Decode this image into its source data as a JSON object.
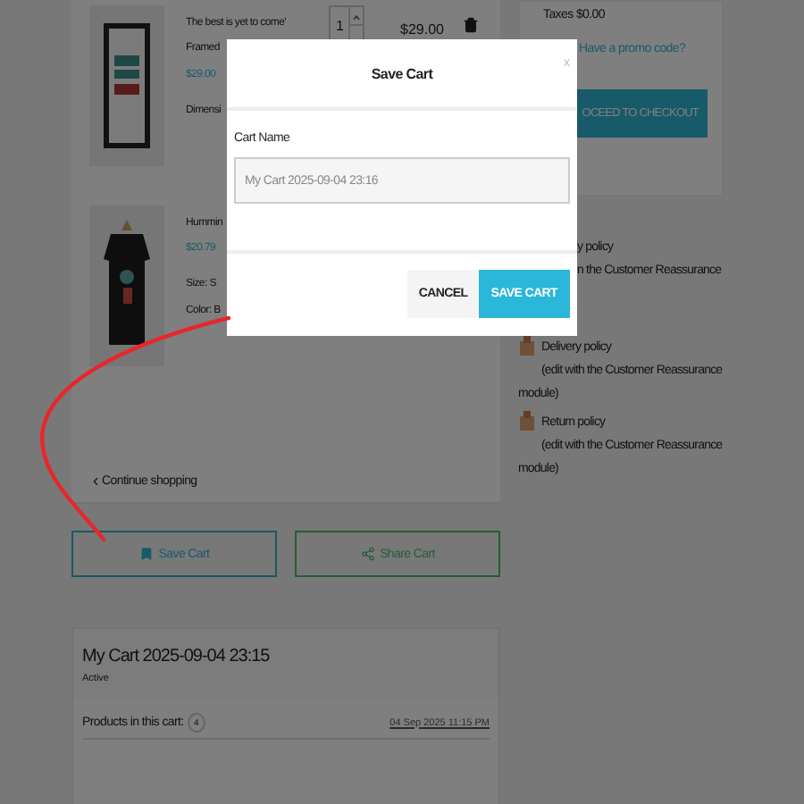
{
  "cart_items": [
    {
      "kind": "poster",
      "quantity": "1",
      "total": "$29.00",
      "lines": [
        {
          "kind": "title",
          "text": "The best is yet to come'"
        },
        {
          "kind": "detail",
          "text": "Framed"
        },
        {
          "kind": "price",
          "text": "$29.00"
        },
        {
          "kind": "detail",
          "text": "Dimensi"
        }
      ]
    },
    {
      "kind": "shirt",
      "lines": [
        {
          "kind": "title",
          "text": "Hummin"
        },
        {
          "kind": "price",
          "text": "$20.79"
        },
        {
          "kind": "detail",
          "text": "Size: S"
        },
        {
          "kind": "detail",
          "text": "Color: B"
        }
      ]
    }
  ],
  "continue_link": "Continue shopping",
  "cart_actions": [
    {
      "kind": "save",
      "label": "Save Cart"
    },
    {
      "kind": "share",
      "label": "Share Cart"
    }
  ],
  "saved_cart": {
    "name": "My Cart 2025-09-04 23:15",
    "status": "Active",
    "products_label": "Products in this cart:",
    "count": "4",
    "date": "04 Sep 2025 11:15 PM"
  },
  "summary": {
    "taxes_label": "Taxes",
    "taxes": "$0.00",
    "promo_link": "Have a promo code?",
    "checkout": "OCEED TO CHECKOUT"
  },
  "policies": [
    {
      "kind": "partial",
      "title": "y policy",
      "text": "n the Customer Reassurance"
    },
    {
      "kind": "full",
      "title": "Delivery policy",
      "text": "(edit with the Customer Reassurance",
      "tail": "module)"
    },
    {
      "kind": "full",
      "title": "Return policy",
      "text": "(edit with the Customer Reassurance",
      "tail": "module)"
    }
  ],
  "modal": {
    "title": "Save Cart",
    "close": "x",
    "field_label": "Cart Name",
    "field_value": "My Cart 2025-09-04 23:16",
    "buttons": [
      {
        "kind": "secondary",
        "label": "CANCEL"
      },
      {
        "kind": "primary",
        "label": "SAVE CART"
      }
    ]
  }
}
